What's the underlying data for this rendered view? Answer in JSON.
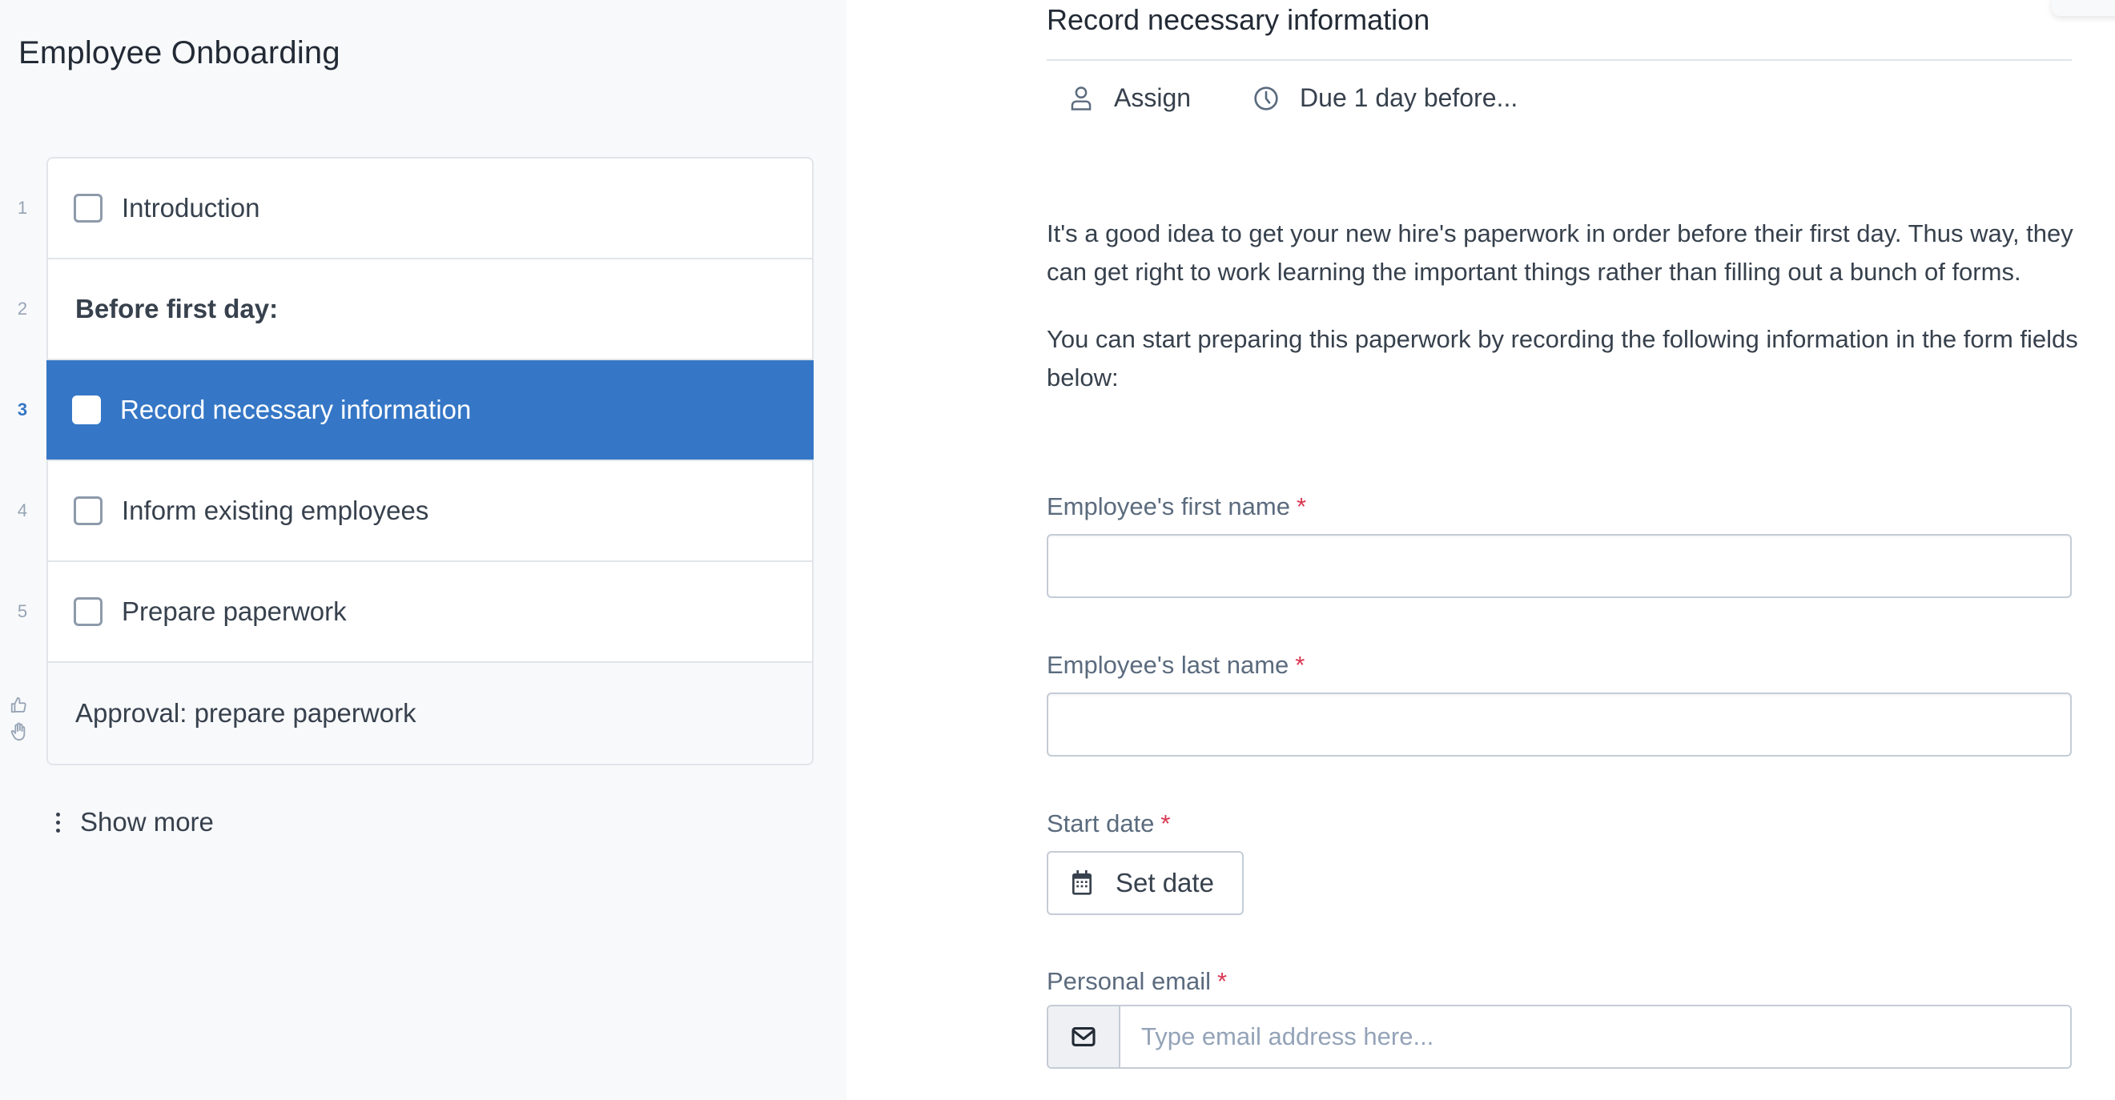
{
  "sidebar": {
    "title": "Employee Onboarding",
    "tasks": [
      {
        "number": "1",
        "label": "Introduction",
        "type": "task",
        "checked": false
      },
      {
        "number": "2",
        "label": "Before first day:",
        "type": "heading"
      },
      {
        "number": "3",
        "label": "Record necessary information",
        "type": "task",
        "checked": false,
        "selected": true
      },
      {
        "number": "4",
        "label": "Inform existing employees",
        "type": "task",
        "checked": false
      },
      {
        "number": "5",
        "label": "Prepare paperwork",
        "type": "task",
        "checked": false
      },
      {
        "label": "Approval: prepare paperwork",
        "type": "approval",
        "icons": [
          "thumbs-up-icon",
          "hand-stop-icon"
        ]
      }
    ],
    "show_more_label": "Show more"
  },
  "task": {
    "title": "Record necessary information",
    "assign_label": "Assign",
    "due_label": "Due 1 day before...",
    "description": [
      "It's a good idea to get your new hire's paperwork in order before their first day. Thus way, they can get right to work learning the important things rather than filling out a bunch of forms.",
      "You can start preparing this paperwork by recording the following information in the form fields below:"
    ]
  },
  "form": {
    "required_marker": "*",
    "first_name": {
      "label": "Employee's first name",
      "value": ""
    },
    "last_name": {
      "label": "Employee's last name",
      "value": ""
    },
    "start_date": {
      "label": "Start date",
      "button_label": "Set date"
    },
    "email": {
      "label": "Personal email",
      "placeholder": "Type email address here...",
      "value": ""
    }
  },
  "colors": {
    "selected": "#3577c6",
    "required": "#d9364f",
    "sidebar_bg": "#f8f9fb"
  }
}
